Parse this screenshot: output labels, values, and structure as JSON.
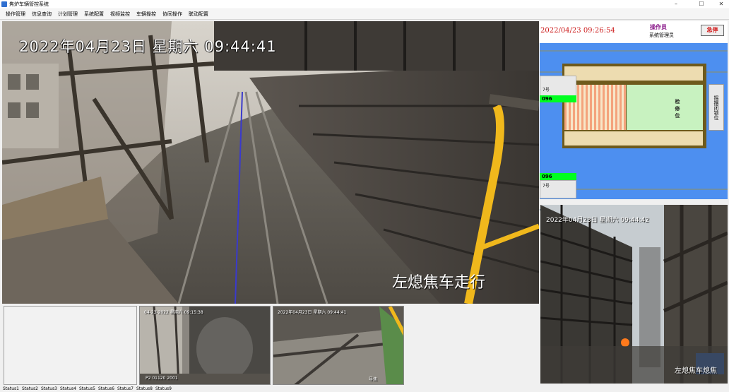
{
  "window": {
    "title": "焦炉车辆管控系统",
    "min": "–",
    "max": "☐",
    "close": "✕"
  },
  "menu": [
    "操作管理",
    "信息查询",
    "计划管理",
    "系统配置",
    "视频监控",
    "车辆操控",
    "协同操作",
    "联动配置"
  ],
  "main_camera": {
    "timestamp": "2022年04月23日  星期六  09:44:41",
    "caption": "左熄焦车走行"
  },
  "control_panel": {
    "datetime": "2022/04/23  09:26:54",
    "role": "操作员",
    "user": "系统管理员",
    "stop_button": "急停",
    "top_tag": {
      "label": "7号",
      "value": "096"
    },
    "bottom_tag": {
      "label": "7号",
      "value": "096"
    },
    "oven_label": "检修位",
    "side_button": "摇摆闭锁位",
    "colors": {
      "blue": "#4d8ff0",
      "green_tag": "#00ff20"
    }
  },
  "right_camera": {
    "timestamp": "2022年04月23日  星期六  09:44:42",
    "caption": "左熄焦车熄焦"
  },
  "thumbnails": [
    {
      "timestamp": "04-23-2022  星期六  09:15:38",
      "caption": "P2 01120    2001"
    },
    {
      "timestamp": "2022年04月23日  星期六  09:44:41",
      "caption": "导焦"
    }
  ],
  "status": [
    "Status1",
    "Status2",
    "Status3",
    "Status4",
    "Status5",
    "Status6",
    "Status7",
    "Status8",
    "Status9"
  ]
}
